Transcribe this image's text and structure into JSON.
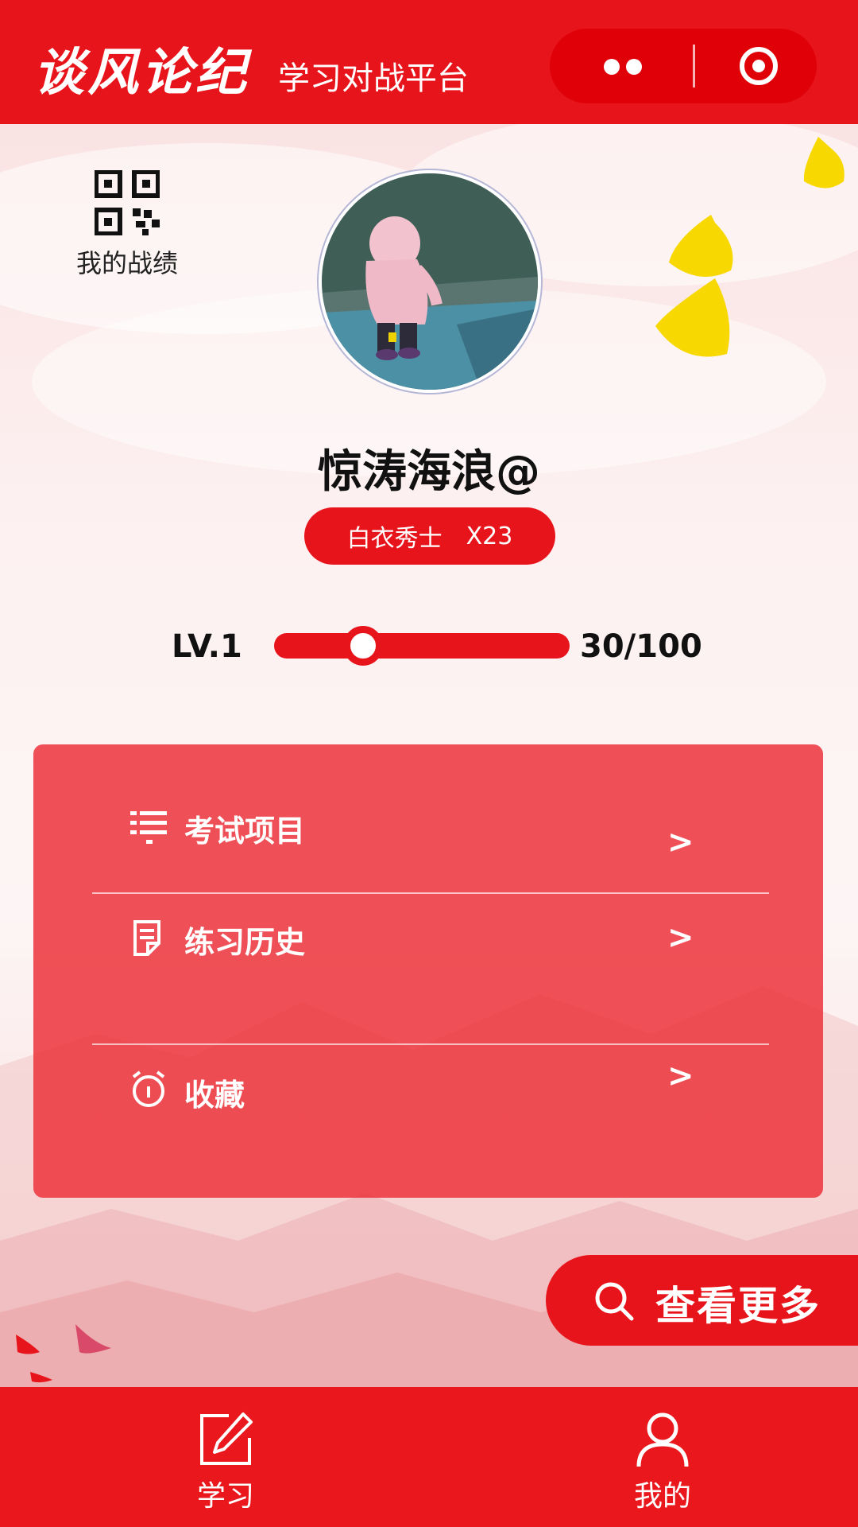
{
  "header": {
    "brand": "谈风论纪",
    "subtitle": "学习对战平台"
  },
  "records": {
    "label": "我的战绩",
    "icon": "qr-code-icon"
  },
  "profile": {
    "username": "惊涛海浪@",
    "rank_title": "白衣秀士",
    "rank_count": "X23"
  },
  "level": {
    "label": "LV.1",
    "current": 30,
    "max": 100,
    "display": "30/100"
  },
  "menu": [
    {
      "label": "考试项目",
      "icon": "list-icon",
      "arrow": ">"
    },
    {
      "label": "练习历史",
      "icon": "document-icon",
      "arrow": ">"
    },
    {
      "label": "收藏",
      "icon": "alarm-clock-icon",
      "arrow": ">"
    }
  ],
  "view_more": {
    "label": "查看更多",
    "icon": "search-icon"
  },
  "tabs": [
    {
      "label": "学习",
      "icon": "edit-icon"
    },
    {
      "label": "我的",
      "icon": "user-icon"
    }
  ],
  "colors": {
    "primary_red": "#e8141b",
    "menu_card": "#ec343c",
    "leaf_yellow": "#f7d800"
  }
}
